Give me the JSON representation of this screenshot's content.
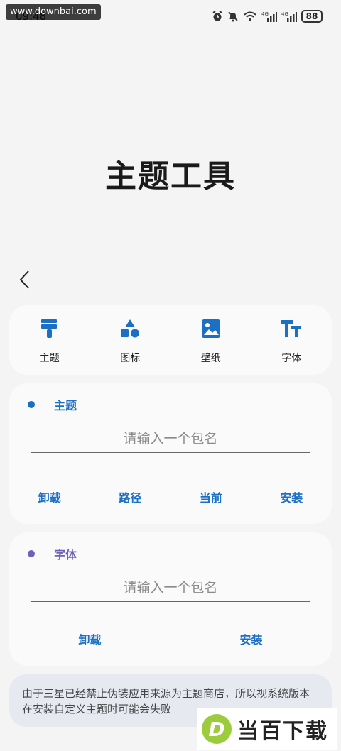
{
  "status": {
    "time": "09:48",
    "watermark": "www.downbai.com",
    "battery": "88"
  },
  "title": "主题工具",
  "nav": {
    "tabs": [
      {
        "label": "主题",
        "icon": "paint-roller-icon"
      },
      {
        "label": "图标",
        "icon": "shapes-icon"
      },
      {
        "label": "壁纸",
        "icon": "image-icon"
      },
      {
        "label": "字体",
        "icon": "font-size-icon"
      }
    ]
  },
  "theme_section": {
    "label": "主题",
    "placeholder": "请输入一个包名",
    "actions": [
      "卸载",
      "路径",
      "当前",
      "安装"
    ],
    "accent": "#1b6fc4"
  },
  "font_section": {
    "label": "字体",
    "placeholder": "请输入一个包名",
    "actions": [
      "卸载",
      "安装"
    ],
    "accent": "#6d62b8"
  },
  "notice": "由于三星已经禁止伪装应用来源为主题商店，所以视系统版本在安装自定义主题时可能会失败",
  "brand": {
    "logo": "D",
    "text": "当百下载"
  }
}
